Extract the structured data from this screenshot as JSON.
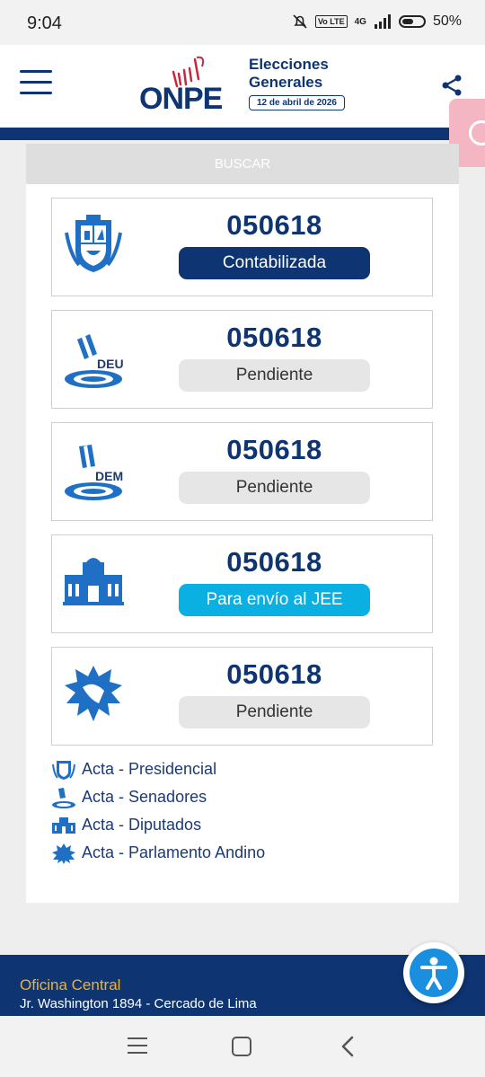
{
  "status_bar": {
    "time": "9:04",
    "network_badge": "Vo LTE",
    "network": "4G",
    "battery": "50%"
  },
  "header": {
    "logo_text": "ONPE",
    "title_line1": "Elecciones",
    "title_line2": "Generales",
    "date": "12 de abril de 2026"
  },
  "search": {
    "label": "BUSCAR"
  },
  "cards": [
    {
      "type": "Presidencial",
      "code": "050618",
      "status": "Contabilizada",
      "status_kind": "done"
    },
    {
      "type": "Senadores DEU",
      "icon_label": "DEU",
      "code": "050618",
      "status": "Pendiente",
      "status_kind": "pending"
    },
    {
      "type": "Senadores DEM",
      "icon_label": "DEM",
      "code": "050618",
      "status": "Pendiente",
      "status_kind": "pending"
    },
    {
      "type": "Diputados",
      "code": "050618",
      "status": "Para envío al JEE",
      "status_kind": "jee"
    },
    {
      "type": "Parlamento Andino",
      "code": "050618",
      "status": "Pendiente",
      "status_kind": "pending"
    }
  ],
  "legend": [
    {
      "label": "Acta - Presidencial",
      "icon": "coat-of-arms-icon"
    },
    {
      "label": "Acta - Senadores",
      "icon": "senate-icon"
    },
    {
      "label": "Acta - Diputados",
      "icon": "congress-building-icon"
    },
    {
      "label": "Acta - Parlamento Andino",
      "icon": "andean-parliament-icon"
    }
  ],
  "footer": {
    "office": "Oficina Central",
    "address": "Jr. Washington 1894 - Cercado de Lima"
  },
  "colors": {
    "brand": "#0e3471",
    "accent_blue": "#0bb0e3",
    "pending": "#e6e6e6",
    "footer_title": "#f2b22f"
  }
}
